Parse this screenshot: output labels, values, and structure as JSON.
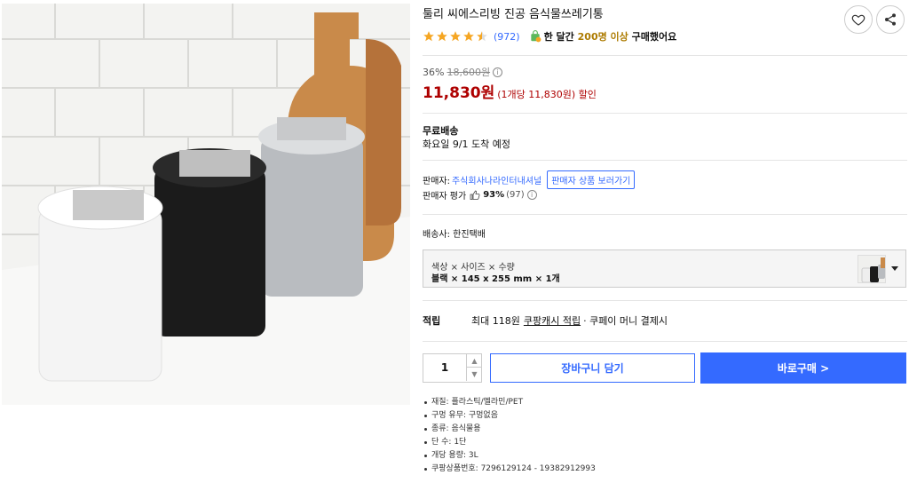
{
  "product": {
    "title": "툴리 씨에스리빙 진공 음식물쓰레기통",
    "rating": 4.5,
    "review_count": "(972)",
    "buy_badge": {
      "prefix": "한 달간",
      "count": "200명 이상",
      "suffix": "구매했어요"
    }
  },
  "price": {
    "discount": "36%",
    "original": "18,600원",
    "sale": "11,830원",
    "unit": "(1개당 11,830원) 할인"
  },
  "shipping": {
    "label": "무료배송",
    "arrival": "화요일 9/1 도착 예정"
  },
  "seller": {
    "label": "판매자:",
    "name": "주식회사나라인터내셔널",
    "link": "판매자 상품 보러가기",
    "rating_label": "판매자 평가",
    "rating_pct": "93%",
    "rating_count": "(97)"
  },
  "courier": "배송사:  한진택배",
  "option": {
    "header": "색상 × 사이즈 × 수량",
    "value": "블랙 × 145 x 255 mm × 1개"
  },
  "reward": {
    "label": "적립",
    "text": "최대 118원",
    "link": "쿠팡캐시 적립",
    "rest": "· 쿠페이 머니 결제시"
  },
  "purchase": {
    "quantity": "1",
    "cart": "장바구니 담기",
    "buy": "바로구매 >"
  },
  "specs": [
    "재질: 플라스틱/멜라민/PET",
    "구멍 유무: 구멍없음",
    "종류: 음식물용",
    "단 수: 1단",
    "개당 용량: 3L",
    "쿠팡상품번호: 7296129124 - 19382912993"
  ],
  "colors": {
    "accent": "#346aff",
    "price_red": "#ae0000",
    "star": "#f5a623",
    "badge_gold": "#ad7b00"
  }
}
